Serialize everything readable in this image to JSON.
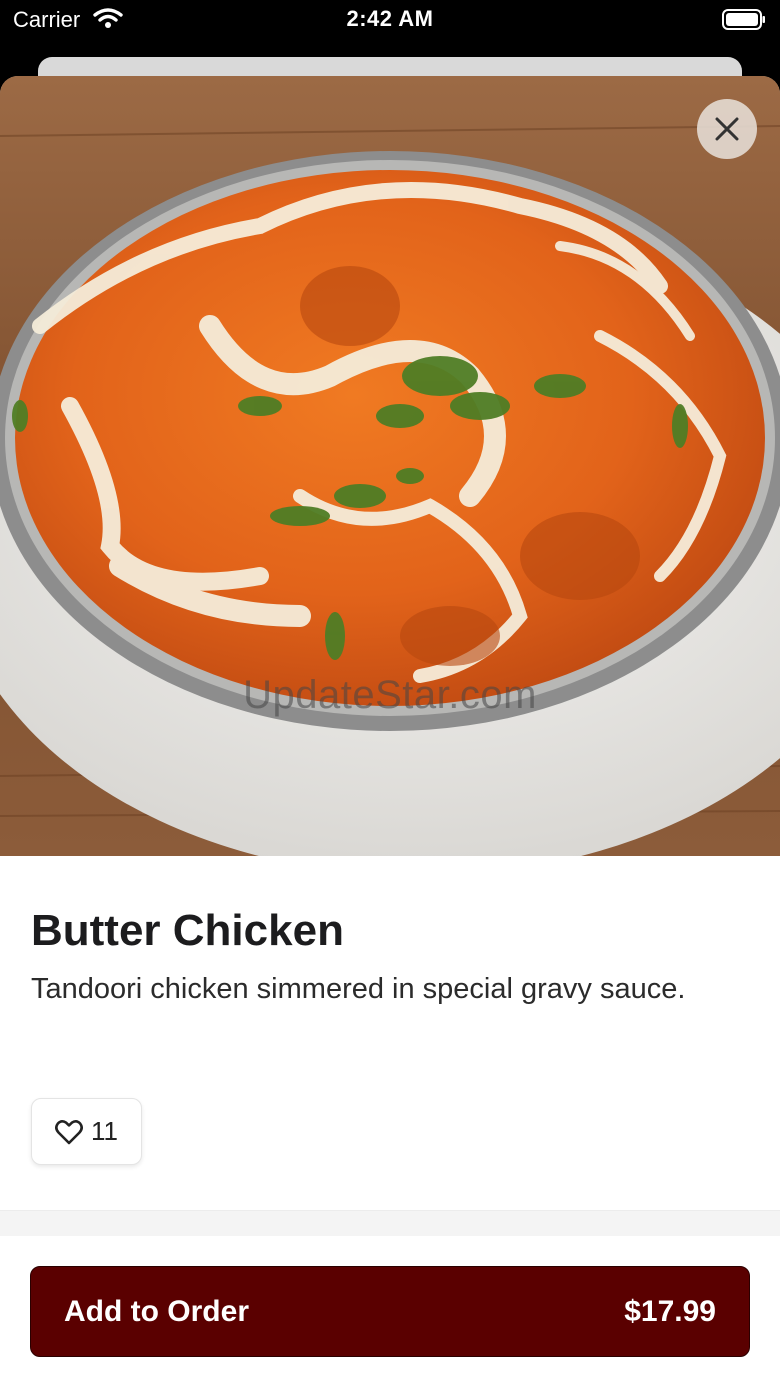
{
  "status_bar": {
    "carrier": "Carrier",
    "time": "2:42 AM"
  },
  "hero": {
    "image": "butter-chicken-photo",
    "watermark": "UpdateStar.com"
  },
  "item": {
    "name": "Butter Chicken",
    "description": "Tandoori chicken simmered in special gravy sauce.",
    "likes": "11"
  },
  "order_button": {
    "label": "Add to Order",
    "price": "$17.99"
  },
  "colors": {
    "accent": "#5a0000",
    "sauce": "#e46a1c",
    "background": "#ffffff"
  },
  "icons": {
    "close": "close-icon",
    "like": "heart-icon",
    "wifi": "wifi-icon",
    "battery": "battery-icon"
  }
}
